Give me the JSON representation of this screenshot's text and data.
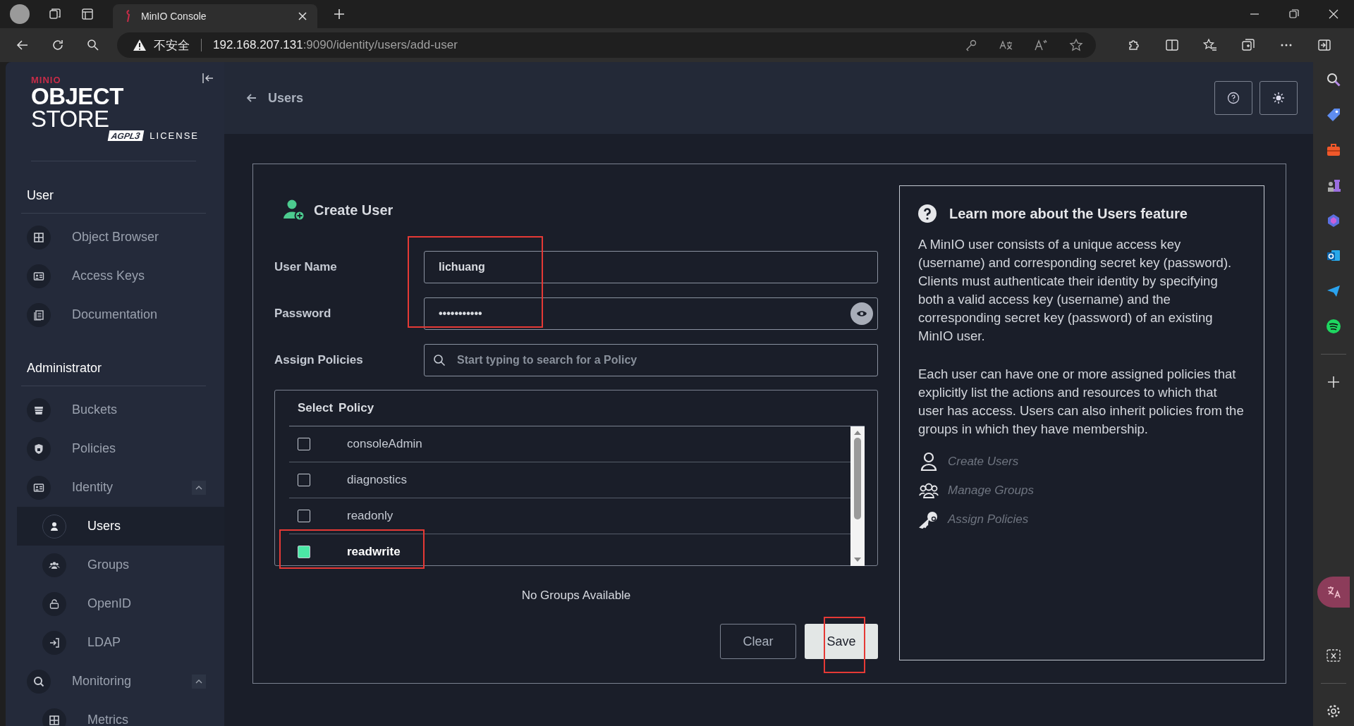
{
  "browser": {
    "tab_title": "MinIO Console",
    "security_label": "不安全",
    "url_host": "192.168.207.131",
    "url_path": ":9090/identity/users/add-user"
  },
  "sidebar": {
    "logo": {
      "brand": "MINIO",
      "product_bold": "OBJECT",
      "product": "STORE",
      "badge": "AGPL",
      "badge_version": "3",
      "license": "LICENSE"
    },
    "sections": [
      {
        "title": "User",
        "items": [
          {
            "label": "Object Browser",
            "selected": false
          },
          {
            "label": "Access Keys",
            "selected": false
          },
          {
            "label": "Documentation",
            "selected": false
          }
        ]
      },
      {
        "title": "Administrator",
        "items": [
          {
            "label": "Buckets",
            "selected": false
          },
          {
            "label": "Policies",
            "selected": false
          },
          {
            "label": "Identity",
            "selected": false,
            "expanded": true,
            "children": [
              {
                "label": "Users",
                "selected": true
              },
              {
                "label": "Groups",
                "selected": false
              },
              {
                "label": "OpenID",
                "selected": false
              },
              {
                "label": "LDAP",
                "selected": false
              }
            ]
          },
          {
            "label": "Monitoring",
            "selected": false,
            "expanded": true,
            "children": [
              {
                "label": "Metrics",
                "selected": false
              }
            ]
          }
        ]
      }
    ]
  },
  "header": {
    "back_label": "Users"
  },
  "form": {
    "title": "Create User",
    "fields": [
      {
        "kind": "text",
        "label": "User Name",
        "value": "lichuang"
      },
      {
        "kind": "password",
        "label": "Password",
        "value": "•••••••••••"
      },
      {
        "kind": "search",
        "label": "Assign Policies",
        "placeholder": "Start typing to search for a Policy"
      }
    ],
    "policy_table": {
      "columns": [
        "Select",
        "Policy"
      ],
      "rows": [
        {
          "name": "consoleAdmin",
          "checked": false
        },
        {
          "name": "diagnostics",
          "checked": false
        },
        {
          "name": "readonly",
          "checked": false
        },
        {
          "name": "readwrite",
          "checked": true
        }
      ]
    },
    "groups_message": "No Groups Available",
    "buttons": [
      {
        "kind": "secondary",
        "label": "Clear"
      },
      {
        "kind": "primary",
        "label": "Save"
      }
    ]
  },
  "help": {
    "title": "Learn more about the Users feature",
    "paragraphs": [
      "A MinIO user consists of a unique access key (username) and corresponding secret key (password). Clients must authenticate their identity by specifying both a valid access key (username) and the corresponding secret key (password) of an existing MinIO user.",
      "Each user can have one or more assigned policies that explicitly list the actions and resources to which that user has access. Users can also inherit policies from the groups in which they have membership."
    ],
    "links": [
      {
        "kind": "user",
        "label": "Create Users"
      },
      {
        "kind": "group",
        "label": "Manage Groups"
      },
      {
        "kind": "key",
        "label": "Assign Policies"
      }
    ]
  }
}
